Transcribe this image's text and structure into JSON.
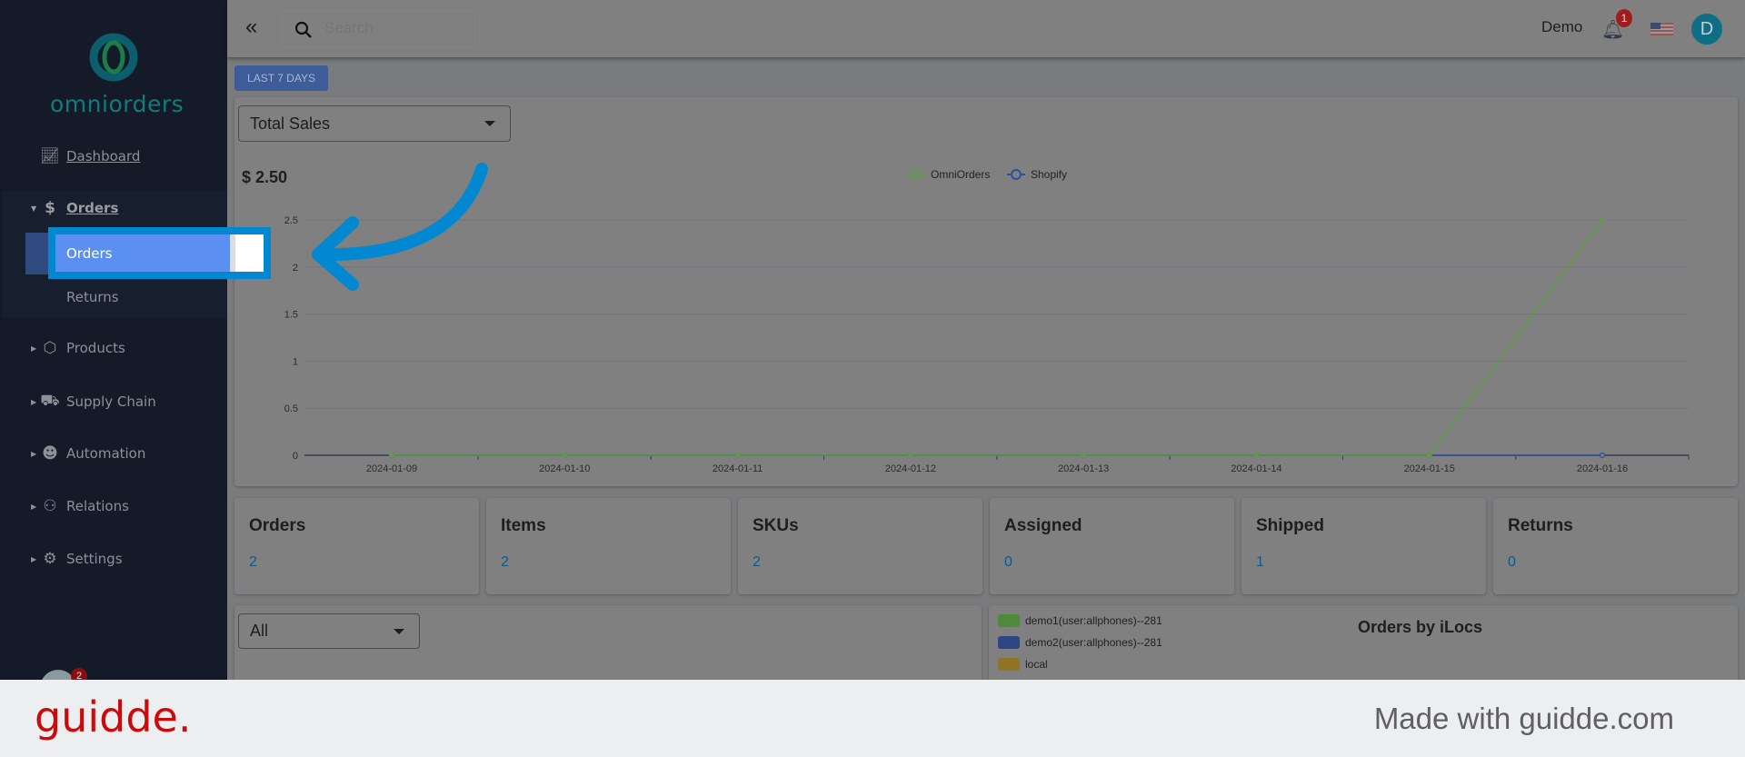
{
  "sidebar": {
    "logo": "omniorders",
    "items": [
      {
        "label": "Dashboard",
        "icon": "chart-line-icon"
      },
      {
        "label": "Orders",
        "icon": "dollar-icon"
      },
      {
        "label": "Orders"
      },
      {
        "label": "Returns"
      },
      {
        "label": "Products",
        "icon": "box-icon"
      },
      {
        "label": "Supply Chain",
        "icon": "truck-icon"
      },
      {
        "label": "Automation",
        "icon": "robot-icon"
      },
      {
        "label": "Relations",
        "icon": "users-icon"
      },
      {
        "label": "Settings",
        "icon": "gears-icon"
      }
    ],
    "bottom_badge": "2"
  },
  "topbar": {
    "search_placeholder": "Search",
    "user": "Demo",
    "notification_count": "1",
    "avatar": "D"
  },
  "filters": {
    "range_button": "LAST 7 DAYS",
    "metric_select": "Total Sales",
    "total": "$ 2.50",
    "secondary_select": "All"
  },
  "chart_data": {
    "type": "line",
    "x": [
      "2024-01-09",
      "2024-01-10",
      "2024-01-11",
      "2024-01-12",
      "2024-01-13",
      "2024-01-14",
      "2024-01-15",
      "2024-01-16"
    ],
    "yticks": [
      "0",
      "0.5",
      "1",
      "1.5",
      "2",
      "2.5"
    ],
    "ylim": [
      0,
      2.5
    ],
    "legend": "top-center",
    "grid": true,
    "series": [
      {
        "name": "OmniOrders",
        "color": "#5aa03c",
        "values": [
          0,
          0,
          0,
          0,
          0,
          0,
          0,
          2.5
        ]
      },
      {
        "name": "Shopify",
        "color": "#2f4f9f",
        "values": [
          0,
          0,
          0,
          0,
          0,
          0,
          0,
          0
        ]
      }
    ]
  },
  "stats": [
    {
      "title": "Orders",
      "value": "2"
    },
    {
      "title": "Items",
      "value": "2"
    },
    {
      "title": "SKUs",
      "value": "2"
    },
    {
      "title": "Assigned",
      "value": "0"
    },
    {
      "title": "Shipped",
      "value": "1"
    },
    {
      "title": "Returns",
      "value": "0"
    }
  ],
  "ilocs": {
    "title": "Orders by iLocs",
    "legend": [
      {
        "label": "demo1(user:allphones)--281",
        "color": "#4e8a3a"
      },
      {
        "label": "demo2(user:allphones)--281",
        "color": "#2c4585"
      },
      {
        "label": "local",
        "color": "#8e7424"
      }
    ]
  },
  "footer": {
    "brand": "guidde.",
    "tagline": "Made with guidde.com"
  },
  "colors": {
    "highlight": "#0288d1",
    "selected": "#5b8ff0"
  }
}
